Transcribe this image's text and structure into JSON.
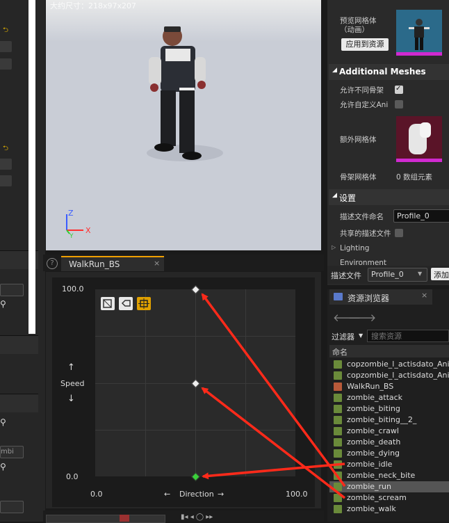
{
  "viewport": {
    "size_text": "大约尺寸：218x97x207",
    "axis_x": "X",
    "axis_y": "Y",
    "axis_z": "Z"
  },
  "blendspace": {
    "tab_label": "WalkRun_BS",
    "y_max": "100.0",
    "y_min": "0.0",
    "x_min": "0.0",
    "x_max": "100.0",
    "y_label": "Speed",
    "x_label": "Direction",
    "y_up_arrow": "↑",
    "y_down_arrow": "↓",
    "x_left_arrow": "←",
    "x_right_arrow": "→"
  },
  "details": {
    "preview_mesh_label": "预览网格体\n（动画）",
    "apply_button": "应用到资源",
    "additional_meshes_header": "Additional Meshes",
    "allow_diff_skeleton": "允许不同骨架",
    "allow_custom_anim": "允许自定义Ani",
    "extra_mesh_label": "额外网格体",
    "skeletal_mesh_label": "骨架网格体",
    "skeletal_mesh_value": "0 数组元素",
    "settings_header": "设置",
    "profile_name_label": "描述文件命名",
    "profile_name_value": "Profile_0",
    "shared_profile_label": "共享的描述文件",
    "lighting_label": "Lighting",
    "environment_label": "Environment",
    "profile_label": "描述文件",
    "profile_select": "Profile_0",
    "add_button": "添加"
  },
  "content_browser": {
    "tab_label": "资源浏览器",
    "filter_label": "过滤器",
    "search_placeholder": "搜索资源",
    "column_name": "命名",
    "items": [
      "copzombie_l_actisdato_Ani",
      "copzombie_l_actisdato_Ani",
      "WalkRun_BS",
      "zombie_attack",
      "zombie_biting",
      "zombie_biting__2_",
      "zombie_crawl",
      "zombie_death",
      "zombie_dying",
      "zombie_idle",
      "zombie_neck_bite",
      "zombie_run",
      "zombie_scream",
      "zombie_walk"
    ],
    "selected_index": 11
  },
  "left_strip": {
    "partial_text": "mbi"
  },
  "colors": {
    "accent": "#f0a000",
    "arrow": "#ff2a1a",
    "selected_row": "#555555"
  }
}
